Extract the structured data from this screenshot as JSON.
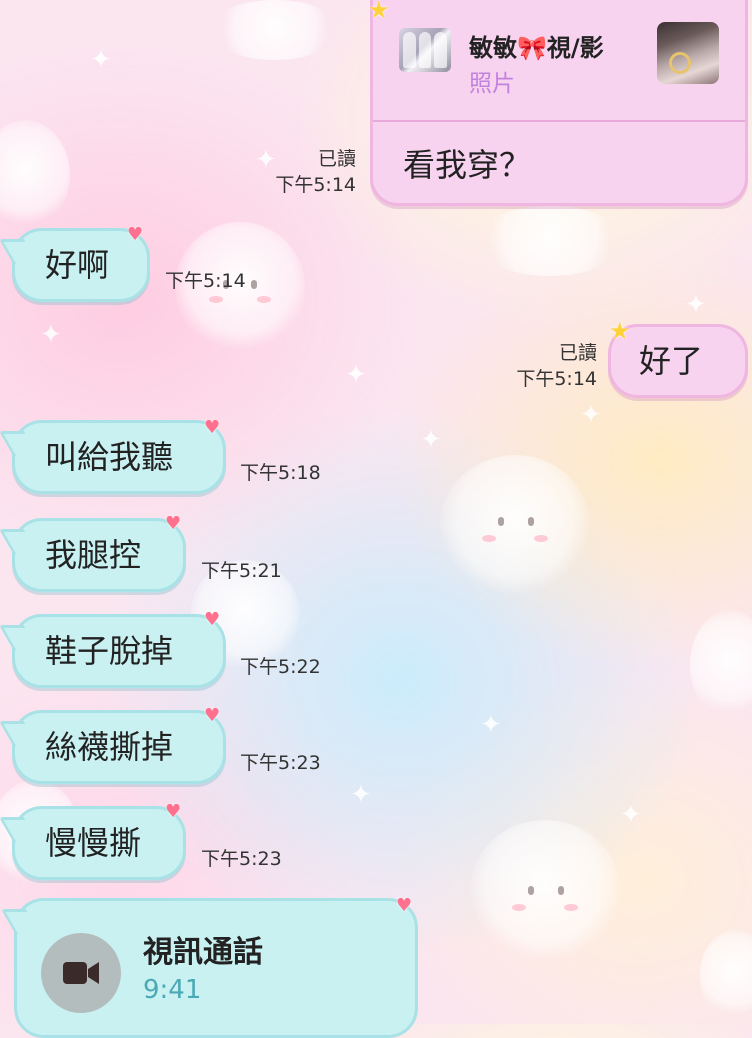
{
  "share_card": {
    "sender_name": "敏敏",
    "bow_icon": "🎀",
    "media_label": "視/影",
    "subtitle": "照片",
    "message": "看我穿？",
    "read_label": "已讀",
    "time": "下午5:14"
  },
  "messages": [
    {
      "text": "好啊",
      "time": "下午5:14"
    },
    {
      "text": "好了",
      "time": "下午5:14",
      "read_label": "已讀"
    },
    {
      "text": "叫給我聽",
      "time": "下午5:18"
    },
    {
      "text": "我腿控",
      "time": "下午5:21"
    },
    {
      "text": "鞋子脫掉",
      "time": "下午5:22"
    },
    {
      "text": "絲襪撕掉",
      "time": "下午5:23"
    },
    {
      "text": "慢慢撕",
      "time": "下午5:23"
    }
  ],
  "video_call": {
    "title": "視訊通話",
    "duration": "9:41",
    "icon": "video-camera-icon"
  },
  "colors": {
    "incoming_bubble": "#c9f1f2",
    "outgoing_bubble": "#f8d3ef",
    "heart": "#ff6f8e",
    "star": "#ffd23a"
  }
}
